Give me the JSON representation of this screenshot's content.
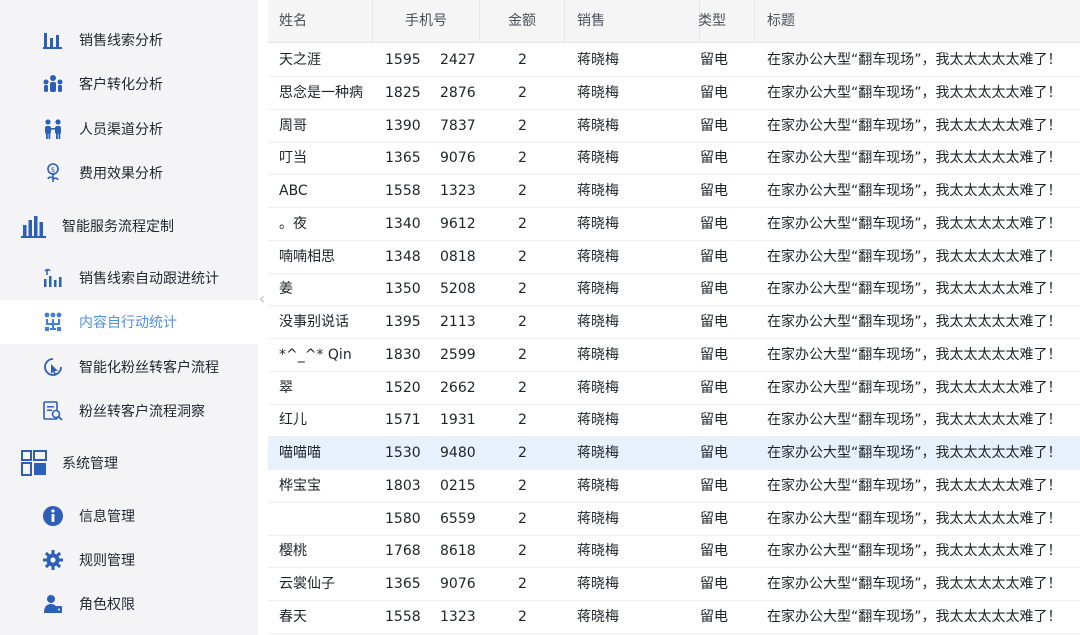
{
  "sidebar": {
    "items": [
      {
        "label": "销售线索分析",
        "icon": "bar-chart-icon",
        "kind": "child"
      },
      {
        "label": "客户转化分析",
        "icon": "people-group-icon",
        "kind": "child"
      },
      {
        "label": "人员渠道分析",
        "icon": "people-pair-icon",
        "kind": "child"
      },
      {
        "label": "费用效果分析",
        "icon": "money-plant-icon",
        "kind": "child"
      },
      {
        "label": "智能服务流程定制",
        "icon": "analytics-bars-icon",
        "kind": "group"
      },
      {
        "label": "销售线索自动跟进统计",
        "icon": "auto-followup-icon",
        "kind": "child"
      },
      {
        "label": "内容自行动统计",
        "icon": "content-action-icon",
        "kind": "child",
        "active": true
      },
      {
        "label": "智能化粉丝转客户流程",
        "icon": "cursor-circle-icon",
        "kind": "child"
      },
      {
        "label": "粉丝转客户流程洞察",
        "icon": "document-search-icon",
        "kind": "child"
      },
      {
        "label": "系统管理",
        "icon": "grid-layout-icon",
        "kind": "group"
      },
      {
        "label": "信息管理",
        "icon": "info-icon",
        "kind": "child"
      },
      {
        "label": "规则管理",
        "icon": "gear-icon",
        "kind": "child"
      },
      {
        "label": "角色权限",
        "icon": "user-role-icon",
        "kind": "child"
      }
    ],
    "collapse_glyph": "‹"
  },
  "table": {
    "columns": [
      "姓名",
      "手机号",
      "金额",
      "销售",
      "类型",
      "标题"
    ],
    "highlight_row": 12,
    "rows": [
      {
        "name": "天之涯",
        "phone_a": "1595",
        "phone_b": "2427",
        "amount": "2",
        "sales": "蒋晓梅",
        "type": "留电",
        "title": "在家办公大型“翻车现场”，我太太太太太难了！"
      },
      {
        "name": "思念是一种病",
        "phone_a": "1825",
        "phone_b": "2876",
        "amount": "2",
        "sales": "蒋晓梅",
        "type": "留电",
        "title": "在家办公大型“翻车现场”，我太太太太太难了！"
      },
      {
        "name": "周哥",
        "phone_a": "1390",
        "phone_b": "7837",
        "amount": "2",
        "sales": "蒋晓梅",
        "type": "留电",
        "title": "在家办公大型“翻车现场”，我太太太太太难了！"
      },
      {
        "name": "叮当",
        "phone_a": "1365",
        "phone_b": "9076",
        "amount": "2",
        "sales": "蒋晓梅",
        "type": "留电",
        "title": "在家办公大型“翻车现场”，我太太太太太难了！"
      },
      {
        "name": "ABC",
        "phone_a": "1558",
        "phone_b": "1323",
        "amount": "2",
        "sales": "蒋晓梅",
        "type": "留电",
        "title": "在家办公大型“翻车现场”，我太太太太太难了！"
      },
      {
        "name": "。夜",
        "phone_a": "1340",
        "phone_b": "9612",
        "amount": "2",
        "sales": "蒋晓梅",
        "type": "留电",
        "title": "在家办公大型“翻车现场”，我太太太太太难了！"
      },
      {
        "name": "喃喃相思",
        "phone_a": "1348",
        "phone_b": "0818",
        "amount": "2",
        "sales": "蒋晓梅",
        "type": "留电",
        "title": "在家办公大型“翻车现场”，我太太太太太难了！"
      },
      {
        "name": "姜",
        "phone_a": "1350",
        "phone_b": "5208",
        "amount": "2",
        "sales": "蒋晓梅",
        "type": "留电",
        "title": "在家办公大型“翻车现场”，我太太太太太难了！"
      },
      {
        "name": "没事别说话",
        "phone_a": "1395",
        "phone_b": "2113",
        "amount": "2",
        "sales": "蒋晓梅",
        "type": "留电",
        "title": "在家办公大型“翻车现场”，我太太太太太难了！"
      },
      {
        "name": "*^_^* Qin",
        "phone_a": "1830",
        "phone_b": "2599",
        "amount": "2",
        "sales": "蒋晓梅",
        "type": "留电",
        "title": "在家办公大型“翻车现场”，我太太太太太难了！"
      },
      {
        "name": "翠",
        "phone_a": "1520",
        "phone_b": "2662",
        "amount": "2",
        "sales": "蒋晓梅",
        "type": "留电",
        "title": "在家办公大型“翻车现场”，我太太太太太难了！"
      },
      {
        "name": "红儿",
        "phone_a": "1571",
        "phone_b": "1931",
        "amount": "2",
        "sales": "蒋晓梅",
        "type": "留电",
        "title": "在家办公大型“翻车现场”，我太太太太太难了！"
      },
      {
        "name": "喵喵喵",
        "phone_a": "1530",
        "phone_b": "9480",
        "amount": "2",
        "sales": "蒋晓梅",
        "type": "留电",
        "title": "在家办公大型“翻车现场”，我太太太太太难了！"
      },
      {
        "name": "桦宝宝",
        "phone_a": "1803",
        "phone_b": "0215",
        "amount": "2",
        "sales": "蒋晓梅",
        "type": "留电",
        "title": "在家办公大型“翻车现场”，我太太太太太难了！"
      },
      {
        "name": "",
        "phone_a": "1580",
        "phone_b": "6559",
        "amount": "2",
        "sales": "蒋晓梅",
        "type": "留电",
        "title": "在家办公大型“翻车现场”，我太太太太太难了！"
      },
      {
        "name": "樱桃",
        "phone_a": "1768",
        "phone_b": "8618",
        "amount": "2",
        "sales": "蒋晓梅",
        "type": "留电",
        "title": "在家办公大型“翻车现场”，我太太太太太难了！"
      },
      {
        "name": "云裳仙子",
        "phone_a": "1365",
        "phone_b": "9076",
        "amount": "2",
        "sales": "蒋晓梅",
        "type": "留电",
        "title": "在家办公大型“翻车现场”，我太太太太太难了！"
      },
      {
        "name": "春天",
        "phone_a": "1558",
        "phone_b": "1323",
        "amount": "2",
        "sales": "蒋晓梅",
        "type": "留电",
        "title": "在家办公大型“翻车现场”，我太太太太太难了！"
      }
    ]
  }
}
